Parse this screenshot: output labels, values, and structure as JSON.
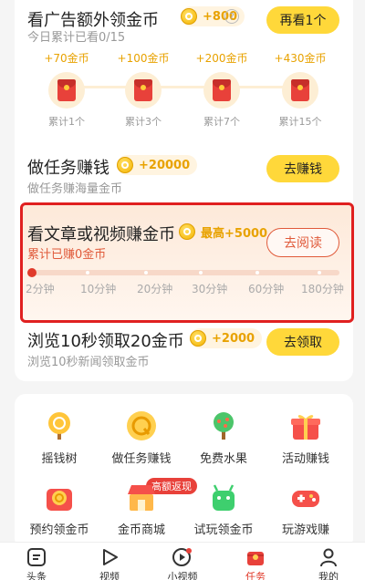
{
  "extra_ad": {
    "title": "看广告额外领金币",
    "reward": "+800",
    "help": "?",
    "subtitle": "今日累计已看0/15",
    "button": "再看1个",
    "milestones": [
      {
        "amount": "+70金币",
        "label": "累计1个"
      },
      {
        "amount": "+100金币",
        "label": "累计3个"
      },
      {
        "amount": "+200金币",
        "label": "累计7个"
      },
      {
        "amount": "+430金币",
        "label": "累计15个"
      }
    ]
  },
  "task_earn": {
    "title": "做任务赚钱",
    "reward": "+20000",
    "subtitle": "做任务赚海量金币",
    "button": "去赚钱"
  },
  "read_earn": {
    "title": "看文章或视频赚金币",
    "reward": "最高+5000",
    "subtitle": "累计已赚0金币",
    "button": "去阅读",
    "progress_fraction": 0,
    "ticks": [
      "2分钟",
      "10分钟",
      "20分钟",
      "30分钟",
      "60分钟",
      "180分钟"
    ]
  },
  "browse": {
    "title": "浏览10秒领取20金币",
    "reward": "+2000",
    "subtitle": "浏览10秒新闻领取金币",
    "button": "去领取"
  },
  "grid": {
    "promo_badge": "高额返现",
    "items": [
      {
        "label": "摇钱树",
        "icon": "money-tree-icon"
      },
      {
        "label": "做任务赚钱",
        "icon": "coin-task-icon"
      },
      {
        "label": "免费水果",
        "icon": "fruit-tree-icon"
      },
      {
        "label": "活动赚钱",
        "icon": "gift-box-icon"
      },
      {
        "label": "预约领金币",
        "icon": "reserve-coin-icon"
      },
      {
        "label": "金币商城",
        "icon": "shop-icon"
      },
      {
        "label": "试玩领金币",
        "icon": "android-robot-icon"
      },
      {
        "label": "玩游戏赚",
        "icon": "gamepad-icon"
      }
    ]
  },
  "nav": {
    "items": [
      {
        "label": "头条",
        "icon": "headline-icon"
      },
      {
        "label": "视频",
        "icon": "play-icon"
      },
      {
        "label": "小视频",
        "icon": "short-video-icon"
      },
      {
        "label": "任务",
        "icon": "task-icon",
        "active": true
      },
      {
        "label": "我的",
        "icon": "profile-icon"
      }
    ]
  },
  "colors": {
    "accent_yellow": "#ffd83a",
    "coin_text": "#e8a200",
    "highlight_border": "#e02020",
    "active_nav": "#e03a2a"
  }
}
